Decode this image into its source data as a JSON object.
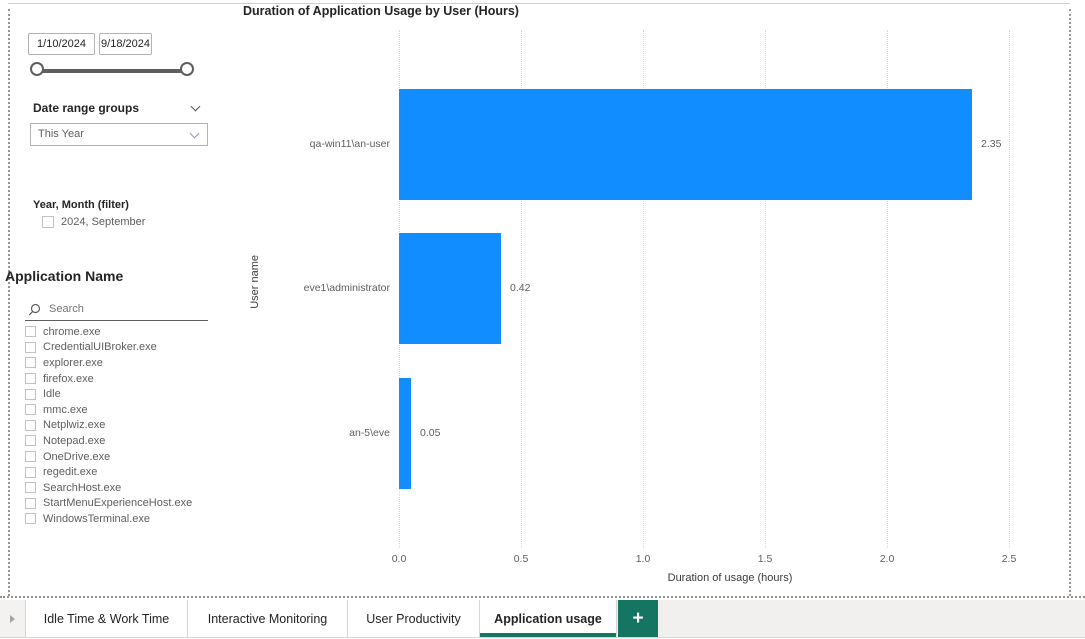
{
  "chart_data": {
    "type": "bar",
    "orientation": "horizontal",
    "title": "Duration of Application Usage by User (Hours)",
    "categories": [
      "qa-win11\\an-user",
      "eve1\\administrator",
      "an-5\\eve"
    ],
    "values": [
      2.35,
      0.42,
      0.05
    ],
    "value_labels": [
      "2.35",
      "0.42",
      "0.05"
    ],
    "xlabel": "Duration of usage (hours)",
    "ylabel": "User name",
    "xlim": [
      0,
      2.5
    ],
    "x_ticks": [
      0,
      0.5,
      1,
      1.5,
      2,
      2.5
    ],
    "x_tick_labels": [
      "0.0",
      "0.5",
      "1.0",
      "1.5",
      "2.0",
      "2.5"
    ],
    "grid": true,
    "legend": false,
    "bar_color": "#118DFF"
  },
  "date_slicer": {
    "start": "1/10/2024",
    "end": "9/18/2024"
  },
  "date_range_groups": {
    "label": "Date range groups",
    "selected": "This Year"
  },
  "year_month_filter": {
    "label": "Year, Month (filter)",
    "options": [
      {
        "label": "2024, September",
        "checked": false
      }
    ]
  },
  "application_filter": {
    "title": "Application Name",
    "search_placeholder": "Search",
    "items": [
      "chrome.exe",
      "CredentialUIBroker.exe",
      "explorer.exe",
      "firefox.exe",
      "Idle",
      "mmc.exe",
      "Netplwiz.exe",
      "Notepad.exe",
      "OneDrive.exe",
      "regedit.exe",
      "SearchHost.exe",
      "StartMenuExperienceHost.exe",
      "WindowsTerminal.exe"
    ]
  },
  "tab_bar": {
    "tabs": [
      "Idle Time & Work Time",
      "Interactive Monitoring",
      "User Productivity",
      "Application usage"
    ],
    "active_tab": "Application usage",
    "add_button": "+"
  },
  "colors": {
    "bar": "#118DFF",
    "active_tab_green": "#147562",
    "grid": "#d8d8d8"
  }
}
